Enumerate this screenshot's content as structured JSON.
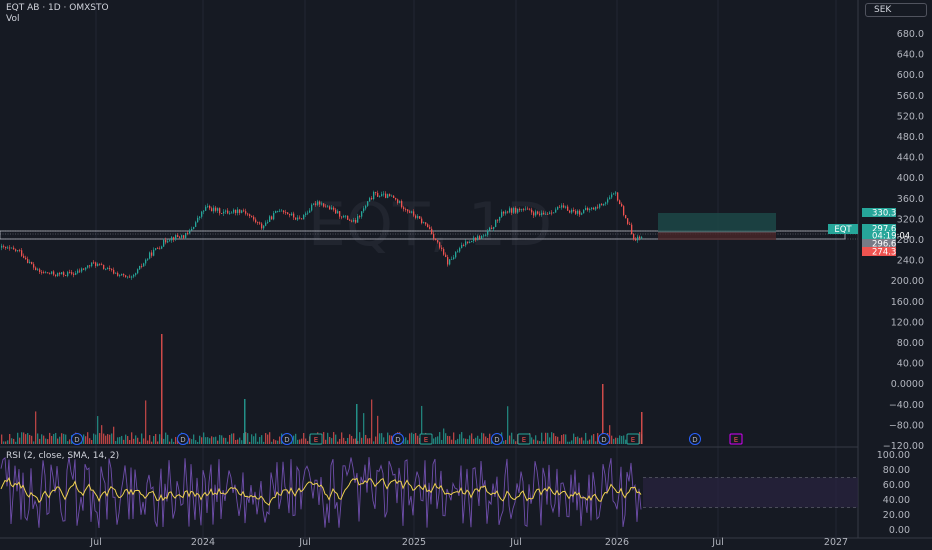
{
  "header": {
    "title": "EQT AB · 1D · OMXSTO",
    "volume_label": "Vol",
    "currency": "SEK"
  },
  "colors": {
    "background": "#161a23",
    "up": "#26a69a",
    "down": "#ef5350",
    "rsi_band": "#7e57c2",
    "rsi_ma": "#f0d250",
    "ticker_tag": "#26a69a"
  },
  "watermark": "EQT, 1D",
  "chart_data": [
    {
      "type": "candlestick",
      "title": "EQT AB · 1D · OMXSTO",
      "time_axis": {
        "labels": [
          "Jul",
          "2024",
          "Jul",
          "2025",
          "Jul",
          "2026",
          "Jul",
          "2027"
        ]
      },
      "y_axis": {
        "ticks": [
          "680.0",
          "640.0",
          "600.0",
          "560.0",
          "520.0",
          "480.0",
          "440.0",
          "400.0",
          "360.0",
          "320.0",
          "280.0",
          "240.0",
          "200.00",
          "160.00",
          "120.00",
          "80.00",
          "40.00",
          "0.0000",
          "−40.00",
          "−80.00",
          "−120.00"
        ],
        "price_range": [
          200,
          400
        ]
      },
      "series_points": [
        {
          "t": "2023-04",
          "p": 262
        },
        {
          "t": "2023-05",
          "p": 255
        },
        {
          "t": "2023-06",
          "p": 215
        },
        {
          "t": "2023-07",
          "p": 210
        },
        {
          "t": "2023-08",
          "p": 212
        },
        {
          "t": "2023-09",
          "p": 232
        },
        {
          "t": "2023-10",
          "p": 215
        },
        {
          "t": "2023-11",
          "p": 200
        },
        {
          "t": "2023-12",
          "p": 248
        },
        {
          "t": "2024-01",
          "p": 280
        },
        {
          "t": "2024-02",
          "p": 286
        },
        {
          "t": "2024-03",
          "p": 340
        },
        {
          "t": "2024-04",
          "p": 330
        },
        {
          "t": "2024-05",
          "p": 335
        },
        {
          "t": "2024-06",
          "p": 302
        },
        {
          "t": "2024-07",
          "p": 338
        },
        {
          "t": "2024-08",
          "p": 315
        },
        {
          "t": "2024-09",
          "p": 352
        },
        {
          "t": "2024-10",
          "p": 330
        },
        {
          "t": "2024-11",
          "p": 310
        },
        {
          "t": "2024-12",
          "p": 365
        },
        {
          "t": "2025-01",
          "p": 360
        },
        {
          "t": "2025-02",
          "p": 330
        },
        {
          "t": "2025-03",
          "p": 300
        },
        {
          "t": "2025-04",
          "p": 232
        },
        {
          "t": "2025-05",
          "p": 275
        },
        {
          "t": "2025-06",
          "p": 285
        },
        {
          "t": "2025-07",
          "p": 332
        },
        {
          "t": "2025-08",
          "p": 336
        },
        {
          "t": "2025-09",
          "p": 324
        },
        {
          "t": "2025-10",
          "p": 340
        },
        {
          "t": "2025-11",
          "p": 330
        },
        {
          "t": "2025-12",
          "p": 340
        },
        {
          "t": "2026-01",
          "p": 366
        },
        {
          "t": "2026-02",
          "p": 280
        }
      ],
      "price_labels": [
        {
          "value": "330.3",
          "color": "#26a69a"
        },
        {
          "value": "297.6",
          "color": "#26a69a"
        },
        {
          "value": "04:19:04",
          "color": "#26a69a"
        },
        {
          "value": "296.6",
          "color": "#787b86"
        },
        {
          "value": "274.3",
          "color": "#ef5350"
        }
      ],
      "ticker_tag": "EQT",
      "event_markers": [
        "D",
        "D",
        "D",
        "E",
        "D",
        "E",
        "D",
        "E",
        "D",
        "E",
        "D",
        "E"
      ]
    },
    {
      "type": "line",
      "title": "RSI (2, close, SMA, 14, 2)",
      "y_axis": {
        "ticks": [
          "100.00",
          "80.00",
          "60.00",
          "40.00",
          "20.00",
          "0.00"
        ],
        "range": [
          0,
          100
        ]
      },
      "series": [
        {
          "name": "RSI"
        },
        {
          "name": "SMA"
        }
      ]
    }
  ]
}
